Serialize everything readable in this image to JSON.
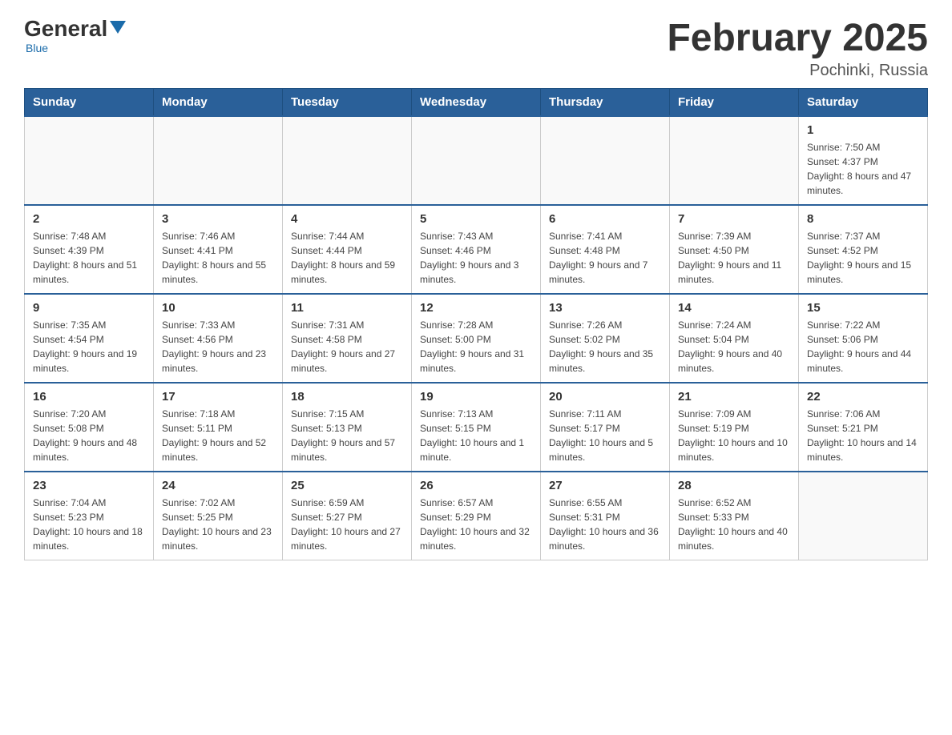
{
  "logo": {
    "general": "General",
    "blue": "Blue",
    "tagline": "Blue"
  },
  "header": {
    "title": "February 2025",
    "subtitle": "Pochinki, Russia"
  },
  "weekdays": [
    "Sunday",
    "Monday",
    "Tuesday",
    "Wednesday",
    "Thursday",
    "Friday",
    "Saturday"
  ],
  "weeks": [
    [
      {
        "day": "",
        "info": ""
      },
      {
        "day": "",
        "info": ""
      },
      {
        "day": "",
        "info": ""
      },
      {
        "day": "",
        "info": ""
      },
      {
        "day": "",
        "info": ""
      },
      {
        "day": "",
        "info": ""
      },
      {
        "day": "1",
        "info": "Sunrise: 7:50 AM\nSunset: 4:37 PM\nDaylight: 8 hours and 47 minutes."
      }
    ],
    [
      {
        "day": "2",
        "info": "Sunrise: 7:48 AM\nSunset: 4:39 PM\nDaylight: 8 hours and 51 minutes."
      },
      {
        "day": "3",
        "info": "Sunrise: 7:46 AM\nSunset: 4:41 PM\nDaylight: 8 hours and 55 minutes."
      },
      {
        "day": "4",
        "info": "Sunrise: 7:44 AM\nSunset: 4:44 PM\nDaylight: 8 hours and 59 minutes."
      },
      {
        "day": "5",
        "info": "Sunrise: 7:43 AM\nSunset: 4:46 PM\nDaylight: 9 hours and 3 minutes."
      },
      {
        "day": "6",
        "info": "Sunrise: 7:41 AM\nSunset: 4:48 PM\nDaylight: 9 hours and 7 minutes."
      },
      {
        "day": "7",
        "info": "Sunrise: 7:39 AM\nSunset: 4:50 PM\nDaylight: 9 hours and 11 minutes."
      },
      {
        "day": "8",
        "info": "Sunrise: 7:37 AM\nSunset: 4:52 PM\nDaylight: 9 hours and 15 minutes."
      }
    ],
    [
      {
        "day": "9",
        "info": "Sunrise: 7:35 AM\nSunset: 4:54 PM\nDaylight: 9 hours and 19 minutes."
      },
      {
        "day": "10",
        "info": "Sunrise: 7:33 AM\nSunset: 4:56 PM\nDaylight: 9 hours and 23 minutes."
      },
      {
        "day": "11",
        "info": "Sunrise: 7:31 AM\nSunset: 4:58 PM\nDaylight: 9 hours and 27 minutes."
      },
      {
        "day": "12",
        "info": "Sunrise: 7:28 AM\nSunset: 5:00 PM\nDaylight: 9 hours and 31 minutes."
      },
      {
        "day": "13",
        "info": "Sunrise: 7:26 AM\nSunset: 5:02 PM\nDaylight: 9 hours and 35 minutes."
      },
      {
        "day": "14",
        "info": "Sunrise: 7:24 AM\nSunset: 5:04 PM\nDaylight: 9 hours and 40 minutes."
      },
      {
        "day": "15",
        "info": "Sunrise: 7:22 AM\nSunset: 5:06 PM\nDaylight: 9 hours and 44 minutes."
      }
    ],
    [
      {
        "day": "16",
        "info": "Sunrise: 7:20 AM\nSunset: 5:08 PM\nDaylight: 9 hours and 48 minutes."
      },
      {
        "day": "17",
        "info": "Sunrise: 7:18 AM\nSunset: 5:11 PM\nDaylight: 9 hours and 52 minutes."
      },
      {
        "day": "18",
        "info": "Sunrise: 7:15 AM\nSunset: 5:13 PM\nDaylight: 9 hours and 57 minutes."
      },
      {
        "day": "19",
        "info": "Sunrise: 7:13 AM\nSunset: 5:15 PM\nDaylight: 10 hours and 1 minute."
      },
      {
        "day": "20",
        "info": "Sunrise: 7:11 AM\nSunset: 5:17 PM\nDaylight: 10 hours and 5 minutes."
      },
      {
        "day": "21",
        "info": "Sunrise: 7:09 AM\nSunset: 5:19 PM\nDaylight: 10 hours and 10 minutes."
      },
      {
        "day": "22",
        "info": "Sunrise: 7:06 AM\nSunset: 5:21 PM\nDaylight: 10 hours and 14 minutes."
      }
    ],
    [
      {
        "day": "23",
        "info": "Sunrise: 7:04 AM\nSunset: 5:23 PM\nDaylight: 10 hours and 18 minutes."
      },
      {
        "day": "24",
        "info": "Sunrise: 7:02 AM\nSunset: 5:25 PM\nDaylight: 10 hours and 23 minutes."
      },
      {
        "day": "25",
        "info": "Sunrise: 6:59 AM\nSunset: 5:27 PM\nDaylight: 10 hours and 27 minutes."
      },
      {
        "day": "26",
        "info": "Sunrise: 6:57 AM\nSunset: 5:29 PM\nDaylight: 10 hours and 32 minutes."
      },
      {
        "day": "27",
        "info": "Sunrise: 6:55 AM\nSunset: 5:31 PM\nDaylight: 10 hours and 36 minutes."
      },
      {
        "day": "28",
        "info": "Sunrise: 6:52 AM\nSunset: 5:33 PM\nDaylight: 10 hours and 40 minutes."
      },
      {
        "day": "",
        "info": ""
      }
    ]
  ]
}
